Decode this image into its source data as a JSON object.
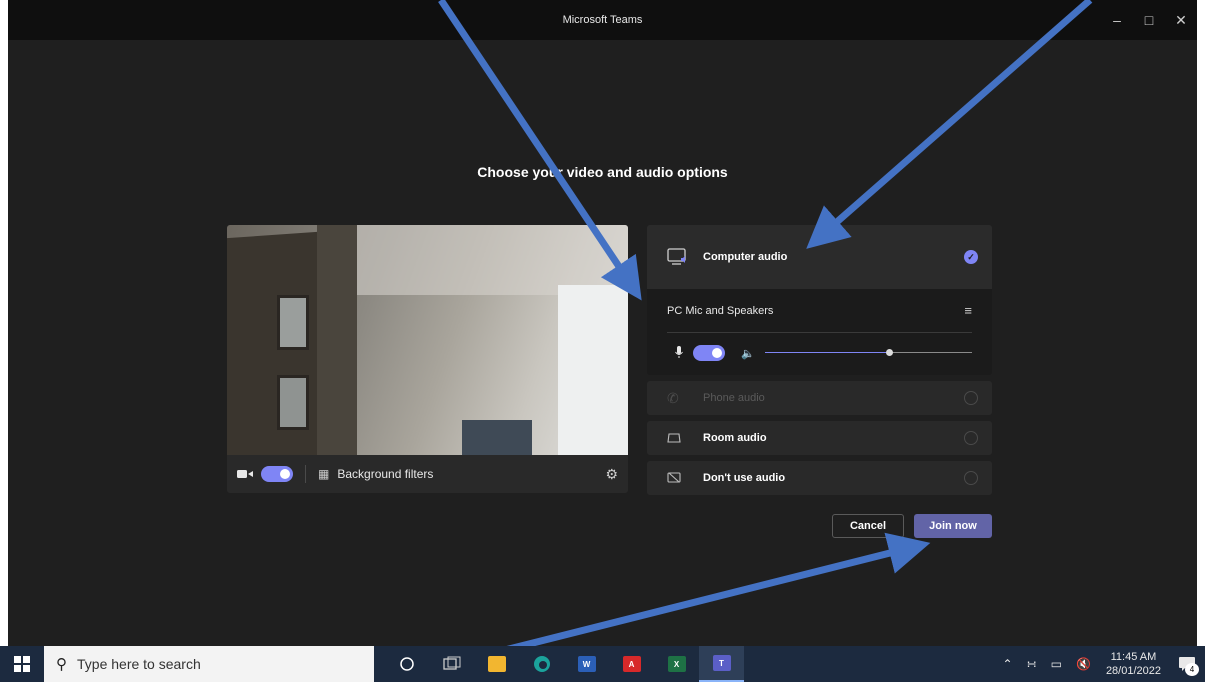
{
  "window": {
    "title": "Microsoft Teams",
    "minimize_glyph": "–",
    "maximize_glyph": "□",
    "close_glyph": "✕"
  },
  "prejoin": {
    "heading": "Choose your video and audio options",
    "video": {
      "camera_on": true,
      "background_filters_label": "Background filters"
    },
    "audio": {
      "computer_audio_label": "Computer audio",
      "device_label": "PC Mic and Speakers",
      "mic_on": true,
      "speaker_volume_fraction": 0.6,
      "phone_audio_label": "Phone audio",
      "room_audio_label": "Room audio",
      "no_audio_label": "Don't use audio",
      "selected": "computer_audio"
    },
    "cancel_label": "Cancel",
    "join_label": "Join now"
  },
  "taskbar": {
    "search_placeholder": "Type here to search",
    "time": "11:45 AM",
    "date": "28/01/2022",
    "notification_count": "4"
  },
  "colors": {
    "accent": "#7f85f5",
    "join_button": "#6264a7",
    "annotation_arrow": "#4472c4"
  },
  "icons": {
    "camera": "camera-icon",
    "background": "background-filter-icon",
    "gear": "gear-icon",
    "computer_audio": "monitor-speaker-icon",
    "device_settings": "sliders-icon",
    "mic": "microphone-icon",
    "speaker": "speaker-icon",
    "phone": "phone-icon",
    "room": "room-icon",
    "no_audio": "no-audio-icon"
  }
}
